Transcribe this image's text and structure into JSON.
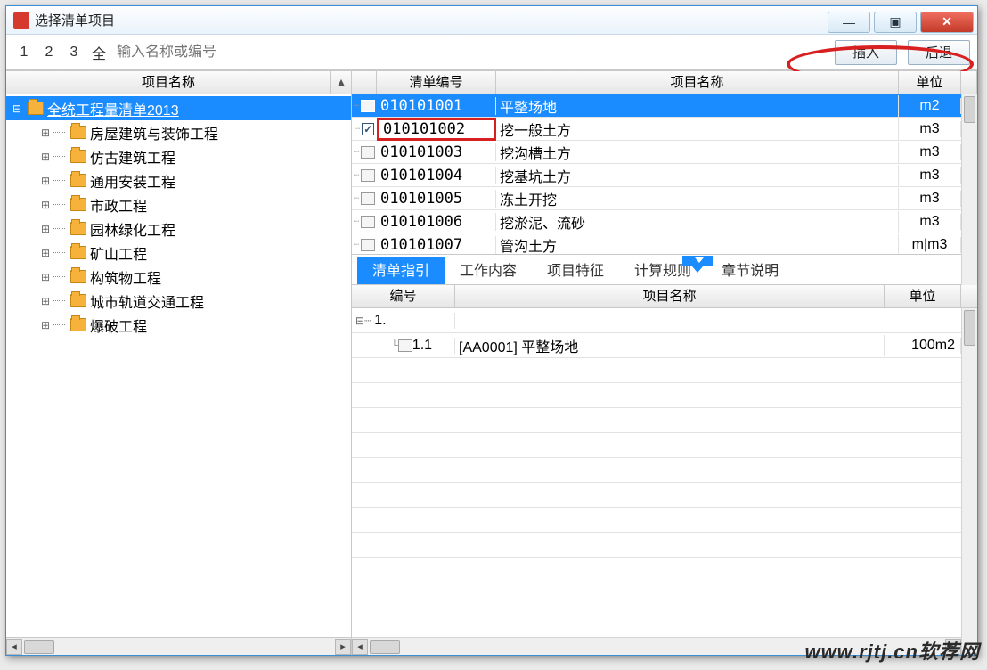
{
  "window": {
    "title": "选择清单项目"
  },
  "toolbar": {
    "b1": "1",
    "b2": "2",
    "b3": "3",
    "ball": "全",
    "search_placeholder": "输入名称或编号",
    "insert": "插入",
    "back": "后退"
  },
  "left": {
    "header": "项目名称",
    "root": "全统工程量清单2013",
    "items": [
      "房屋建筑与装饰工程",
      "仿古建筑工程",
      "通用安装工程",
      "市政工程",
      "园林绿化工程",
      "矿山工程",
      "构筑物工程",
      "城市轨道交通工程",
      "爆破工程"
    ]
  },
  "grid_top": {
    "h0": "",
    "h1": "清单编号",
    "h2": "项目名称",
    "h3": "单位",
    "rows": [
      {
        "code": "010101001",
        "name": "平整场地",
        "unit": "m2",
        "sel": true
      },
      {
        "code": "010101002",
        "name": "挖一般土方",
        "unit": "m3",
        "checked": true,
        "redbox": true
      },
      {
        "code": "010101003",
        "name": "挖沟槽土方",
        "unit": "m3"
      },
      {
        "code": "010101004",
        "name": "挖基坑土方",
        "unit": "m3"
      },
      {
        "code": "010101005",
        "name": "冻土开挖",
        "unit": "m3"
      },
      {
        "code": "010101006",
        "name": "挖淤泥、流砂",
        "unit": "m3"
      },
      {
        "code": "010101007",
        "name": "管沟土方",
        "unit": "m|m3"
      }
    ]
  },
  "tabs": {
    "t0": "清单指引",
    "t1": "工作内容",
    "t2": "项目特征",
    "t3": "计算规则",
    "t4": "章节说明"
  },
  "grid_bot": {
    "h0": "编号",
    "h1": "项目名称",
    "h2": "单位",
    "rows": [
      {
        "num": "1.",
        "name": "",
        "unit": "",
        "parent": true
      },
      {
        "num": "1.1",
        "name": "[AA0001] 平整场地",
        "unit": "100m2"
      }
    ]
  },
  "watermark": "www.rjtj.cn软荐网"
}
